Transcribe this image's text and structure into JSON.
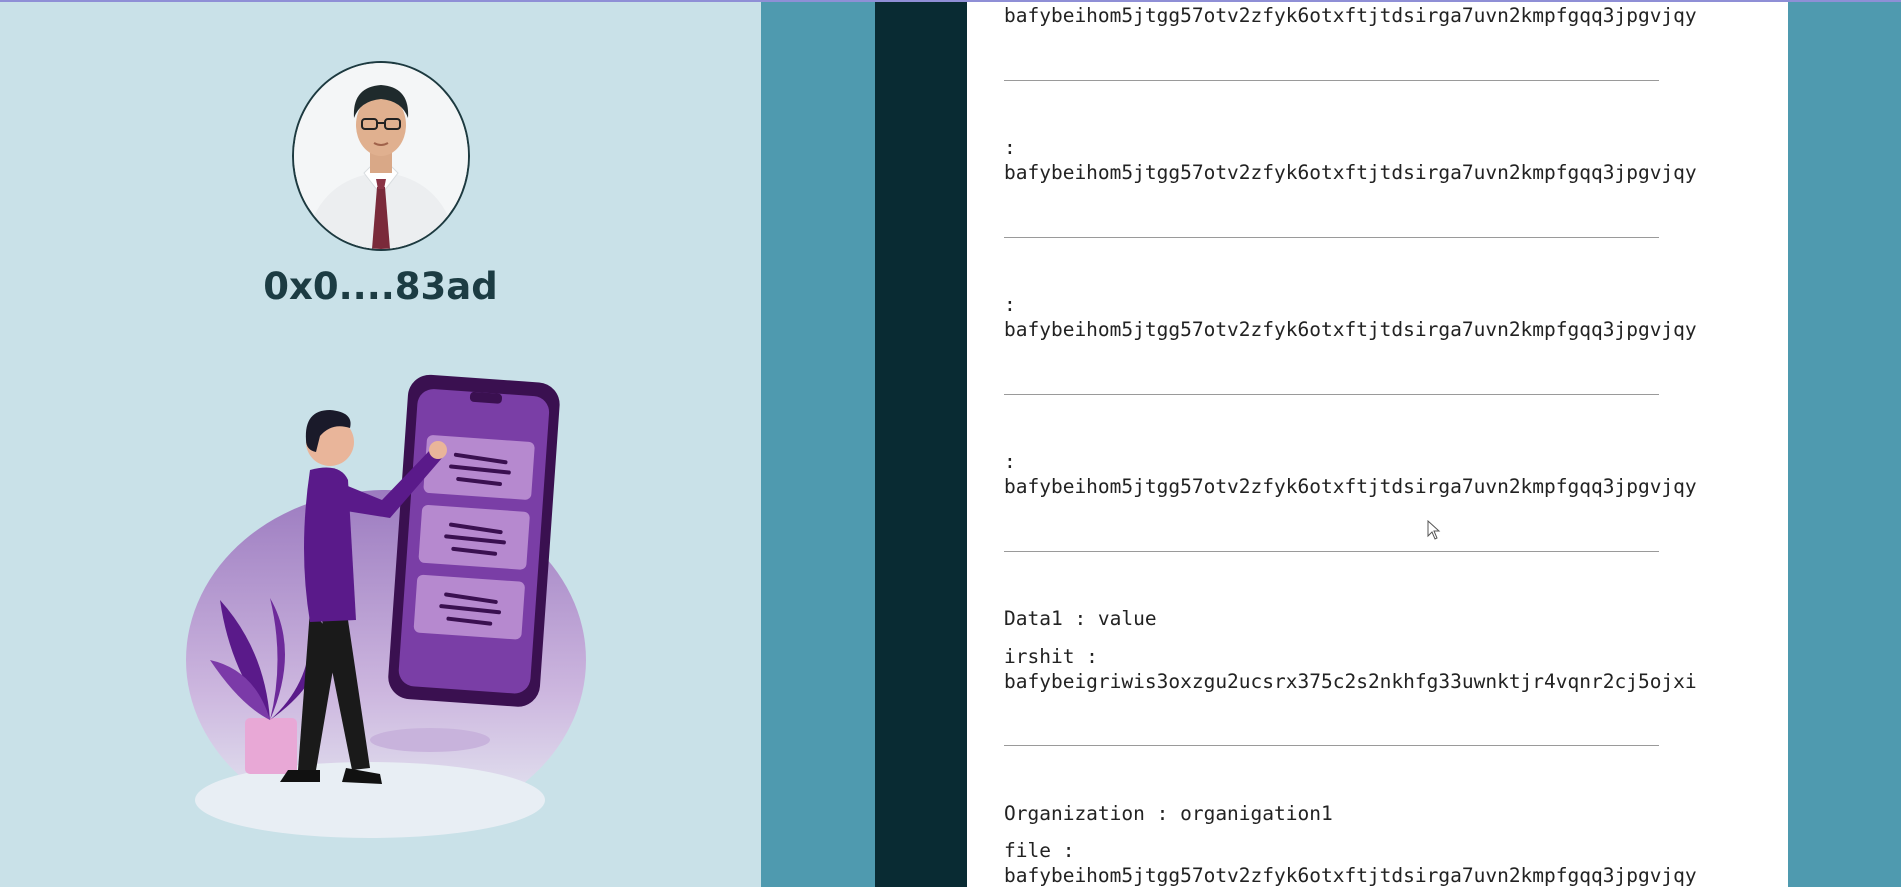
{
  "profile": {
    "wallet_address": "0x0....83ad"
  },
  "records": [
    {
      "label": "",
      "value": "bafybeihom5jtgg57otv2zfyk6otxftjtdsirga7uvn2kmpfgqq3jpgvjqy"
    },
    {
      "label": ":",
      "value": "bafybeihom5jtgg57otv2zfyk6otxftjtdsirga7uvn2kmpfgqq3jpgvjqy"
    },
    {
      "label": ":",
      "value": "bafybeihom5jtgg57otv2zfyk6otxftjtdsirga7uvn2kmpfgqq3jpgvjqy"
    },
    {
      "label": ":",
      "value": "bafybeihom5jtgg57otv2zfyk6otxftjtdsirga7uvn2kmpfgqq3jpgvjqy"
    }
  ],
  "data_record": {
    "line1": "Data1 : value",
    "label": "irshit :",
    "value": "bafybeigriwis3oxzgu2ucsrx375c2s2nkhfg33uwnktjr4vqnr2cj5ojxi"
  },
  "org_record": {
    "line1": "Organization : organigation1",
    "label": "file :",
    "value": "bafybeihom5jtgg57otv2zfyk6otxftjtdsirga7uvn2kmpfgqq3jpgvjqy"
  },
  "colors": {
    "left_bg": "#c9e1e8",
    "teal": "#4f9aaf",
    "dark": "#092b33",
    "purple": "#5a1a8a",
    "text_dark": "#1c3c43"
  }
}
